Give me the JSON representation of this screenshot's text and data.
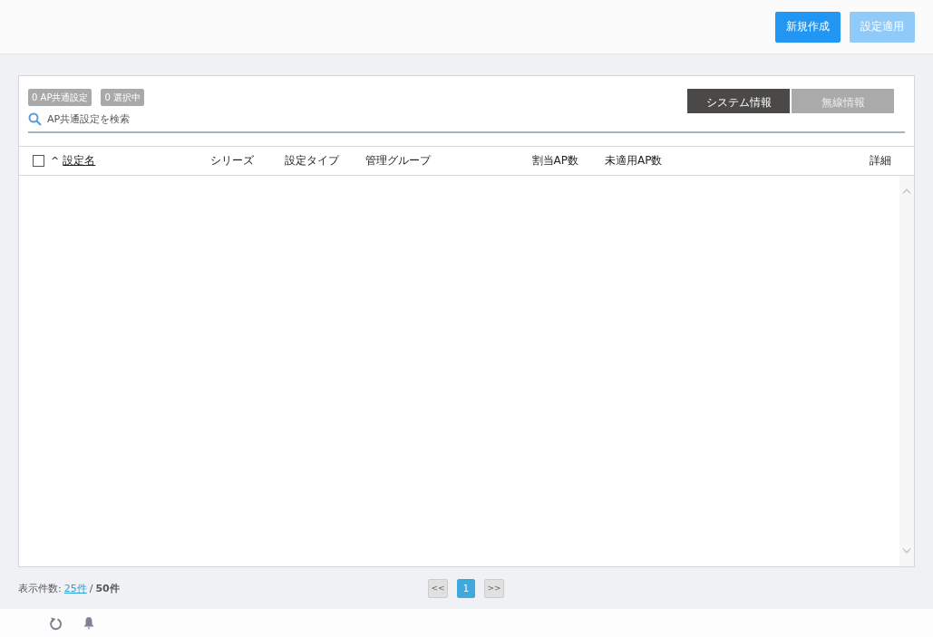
{
  "header": {
    "buttons": [
      {
        "label": "新規作成",
        "disabled": false
      },
      {
        "label": "設定適用",
        "disabled": true
      }
    ]
  },
  "panel": {
    "badges": [
      "0 AP共通設定",
      "0 選択中"
    ],
    "tabs": [
      {
        "label": "システム情報",
        "selected": true
      },
      {
        "label": "無線情報",
        "selected": false
      }
    ],
    "search": {
      "placeholder": "AP共通設定を検索"
    },
    "table": {
      "select_all": {
        "checked": false
      },
      "columns": [
        {
          "label": "設定名",
          "sort_indicator": "^"
        },
        {
          "label": "シリーズ"
        },
        {
          "label": "設定タイプ"
        },
        {
          "label": "管理グループ"
        },
        {
          "label": "割当AP数"
        },
        {
          "label": "未適用AP数"
        },
        {
          "label": "詳細"
        }
      ]
    }
  },
  "footer": {
    "page_size": {
      "label": "表示件数:",
      "link": "25件",
      "separator": "/",
      "total": "50件"
    },
    "pagination": {
      "prev": "<<",
      "pages": [
        {
          "label": "1",
          "selected": true
        }
      ],
      "next": ">>"
    }
  }
}
